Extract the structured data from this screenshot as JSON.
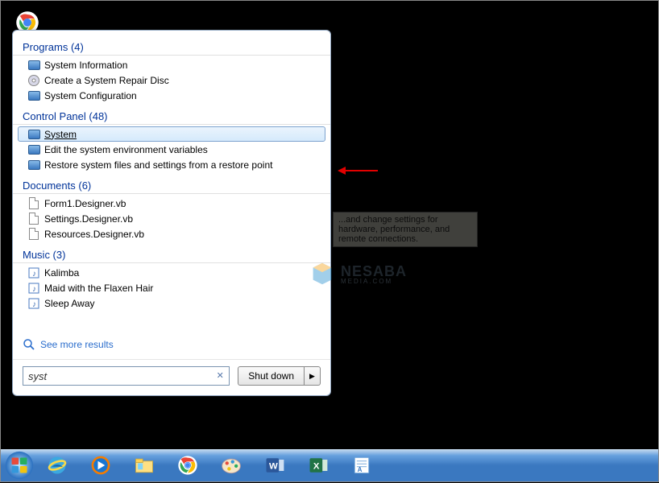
{
  "desktop": {
    "chrome_icon": "chrome"
  },
  "startmenu": {
    "sections": {
      "programs": {
        "header": "Programs (4)",
        "items": [
          "System Information",
          "Create a System Repair Disc",
          "System Configuration"
        ]
      },
      "controlpanel": {
        "header": "Control Panel (48)",
        "items": [
          "System",
          "Edit the system environment variables",
          "Restore system files and settings from a restore point"
        ],
        "selected_index": 0
      },
      "documents": {
        "header": "Documents (6)",
        "items": [
          "Form1.Designer.vb",
          "Settings.Designer.vb",
          "Resources.Designer.vb"
        ]
      },
      "music": {
        "header": "Music (3)",
        "items": [
          "Kalimba",
          "Maid with the Flaxen Hair",
          "Sleep Away"
        ]
      }
    },
    "see_more": "See more results",
    "search_value": "syst",
    "shutdown_label": "Shut down"
  },
  "tooltip": "...and change settings for hardware, performance, and remote connections.",
  "watermark": {
    "text": "NESABA",
    "sub": "MEDIA.COM"
  },
  "taskbar": {
    "items": [
      "start",
      "ie",
      "mediaplayer",
      "explorer",
      "chrome",
      "paint",
      "word",
      "excel",
      "wordpad"
    ]
  }
}
